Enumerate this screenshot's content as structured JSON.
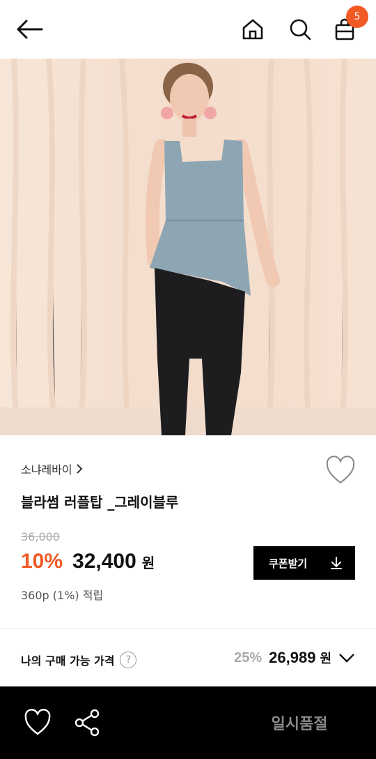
{
  "header": {
    "cart_count": "5",
    "icons": [
      "back-arrow-icon",
      "home-icon",
      "search-icon",
      "shopping-bag-icon"
    ]
  },
  "product": {
    "brand": "소냐레바이",
    "name": "블라썸 러플탑 _그레이블루",
    "original_price": "36,000",
    "discount_rate": "10%",
    "sale_price": "32,400",
    "currency": "원",
    "points": "360p (1%) 적립",
    "coupon_label": "쿠폰받기"
  },
  "my_price": {
    "label": "나의 구매 가능 가격",
    "help": "?",
    "rate": "25%",
    "price": "26,989",
    "currency": "원"
  },
  "bottom_bar": {
    "status_label": "일시품절"
  },
  "colors": {
    "accent": "#f15a24",
    "bottom_bar": "#000000",
    "coupon_button": "#000000"
  }
}
